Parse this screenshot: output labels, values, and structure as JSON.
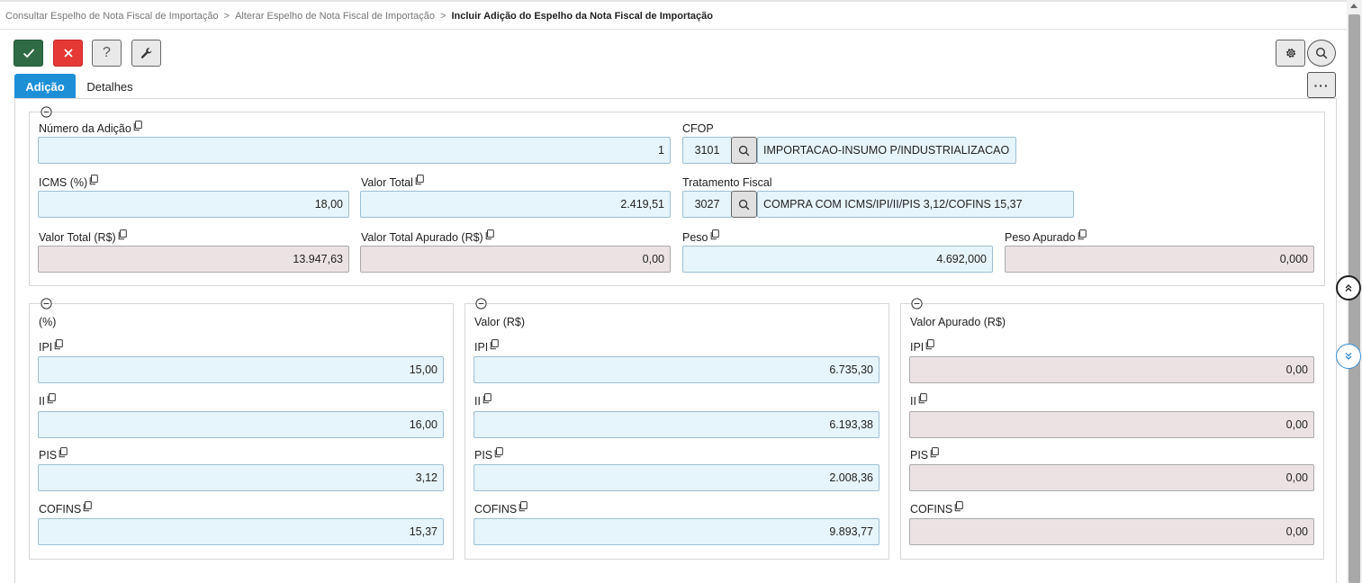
{
  "breadcrumb": {
    "items": [
      "Consultar Espelho de Nota Fiscal de Importação",
      "Alterar Espelho de Nota Fiscal de Importação"
    ],
    "current": "Incluir Adição do Espelho da Nota Fiscal de Importação",
    "separator": ">"
  },
  "toolbar": {
    "confirm_icon": "check-icon",
    "cancel_icon": "close-icon",
    "help_label": "?",
    "tools_icon": "wrench-icon",
    "settings_icon": "gear-icon",
    "search_icon": "search-icon",
    "more_label": "···"
  },
  "tabs": [
    {
      "label": "Adição",
      "active": true
    },
    {
      "label": "Detalhes",
      "active": false
    }
  ],
  "top_group": {
    "numero_adicao": {
      "label": "Número da Adição",
      "value": "1"
    },
    "cfop": {
      "label": "CFOP",
      "code": "3101",
      "description": "IMPORTACAO-INSUMO P/INDUSTRIALIZACAO"
    },
    "icms": {
      "label": "ICMS (%)",
      "value": "18,00"
    },
    "valor_total": {
      "label": "Valor Total",
      "value": "2.419,51"
    },
    "tratamento_fiscal": {
      "label": "Tratamento Fiscal",
      "code": "3027",
      "description": "COMPRA COM ICMS/IPI/II/PIS 3,12/COFINS 15,37"
    },
    "valor_total_rs": {
      "label": "Valor Total (R$)",
      "value": "13.947,63"
    },
    "valor_total_apurado": {
      "label": "Valor Total Apurado (R$)",
      "value": "0,00"
    },
    "peso": {
      "label": "Peso",
      "value": "4.692,000"
    },
    "peso_apurado": {
      "label": "Peso Apurado",
      "value": "0,000"
    }
  },
  "percent_group": {
    "title": "(%)",
    "ipi": {
      "label": "IPI",
      "value": "15,00"
    },
    "ii": {
      "label": "II",
      "value": "16,00"
    },
    "pis": {
      "label": "PIS",
      "value": "3,12"
    },
    "cofins": {
      "label": "COFINS",
      "value": "15,37"
    }
  },
  "valor_group": {
    "title": "Valor (R$)",
    "ipi": {
      "label": "IPI",
      "value": "6.735,30"
    },
    "ii": {
      "label": "II",
      "value": "6.193,38"
    },
    "pis": {
      "label": "PIS",
      "value": "2.008,36"
    },
    "cofins": {
      "label": "COFINS",
      "value": "9.893,77"
    }
  },
  "apurado_group": {
    "title": "Valor Apurado (R$)",
    "ipi": {
      "label": "IPI",
      "value": "0,00"
    },
    "ii": {
      "label": "II",
      "value": "0,00"
    },
    "pis": {
      "label": "PIS",
      "value": "0,00"
    },
    "cofins": {
      "label": "COFINS",
      "value": "0,00"
    }
  },
  "colors": {
    "confirm": "#2f6b45",
    "cancel": "#e53935",
    "tab_active": "#1d8fd6",
    "field_editable": "#e6f4fb",
    "field_readonly": "#ebe3e3"
  }
}
